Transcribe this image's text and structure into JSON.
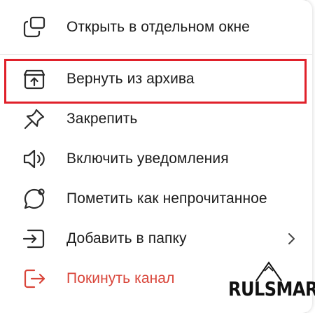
{
  "menu": {
    "items": [
      {
        "label": "Открыть в отдельном окне",
        "icon": "open-window-icon"
      },
      {
        "label": "Вернуть из архива",
        "icon": "unarchive-icon"
      },
      {
        "label": "Закрепить",
        "icon": "pin-icon"
      },
      {
        "label": "Включить уведомления",
        "icon": "speaker-icon"
      },
      {
        "label": "Пометить как непрочитанное",
        "icon": "chat-bubble-icon"
      },
      {
        "label": "Добавить в папку",
        "icon": "folder-add-icon"
      },
      {
        "label": "Покинуть канал",
        "icon": "leave-icon"
      }
    ],
    "highlight_color": "#e0202a",
    "danger_color": "#d9453a"
  },
  "watermark": {
    "text": "RULSMART"
  }
}
